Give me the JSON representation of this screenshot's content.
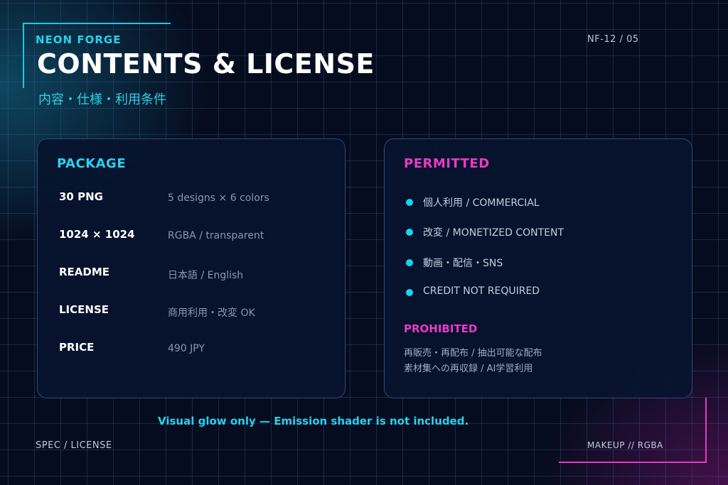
{
  "header": {
    "brand": "NEON FORGE",
    "code": "NF-12 / 05",
    "title": "CONTENTS & LICENSE",
    "subtitle": "内容・仕様・利用条件"
  },
  "package": {
    "heading": "PACKAGE",
    "rows": [
      {
        "label": "30 PNG",
        "value": "5 designs × 6 colors"
      },
      {
        "label": "1024 × 1024",
        "value": "RGBA / transparent"
      },
      {
        "label": "README",
        "value": "日本語 / English"
      },
      {
        "label": "LICENSE",
        "value": "商用利用・改変 OK"
      },
      {
        "label": "PRICE",
        "value": "490 JPY"
      }
    ]
  },
  "permitted": {
    "heading": "PERMITTED",
    "items": [
      "個人利用 / COMMERCIAL",
      "改変 / MONETIZED CONTENT",
      "動画・配信・SNS",
      "CREDIT NOT REQUIRED"
    ]
  },
  "prohibited": {
    "heading": "PROHIBITED",
    "lines": [
      "再販売・再配布 / 抽出可能な配布",
      "素材集への再収録 / AI学習利用"
    ]
  },
  "note": "Visual glow only — Emission shader is not included.",
  "footer": {
    "left": "SPEC / LICENSE",
    "right": "MAKEUP // RGBA"
  },
  "colors": {
    "cyan": "#2ad1ec",
    "magenta": "#e83cc4",
    "background": "#060c1f"
  }
}
